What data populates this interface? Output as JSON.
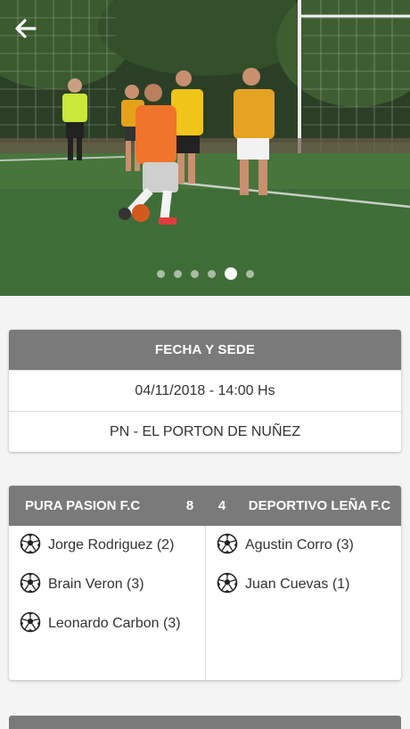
{
  "nav": {
    "back_icon": "arrow-left-icon"
  },
  "carousel": {
    "total": 6,
    "active_index": 4
  },
  "venue": {
    "header": "FECHA Y SEDE",
    "datetime": "04/11/2018 - 14:00 Hs",
    "location": "PN - EL PORTON DE NUÑEZ"
  },
  "match": {
    "home_team": "PURA PASION F.C",
    "home_score": "8",
    "away_score": "4",
    "away_team": "DEPORTIVO LEÑA F.C",
    "home_scorers": [
      "Jorge Rodriguez (2)",
      "Brain Veron (3)",
      "Leonardo Carbon (3)"
    ],
    "away_scorers": [
      "Agustin Corro (3)",
      "Juan Cuevas (1)"
    ]
  },
  "colors": {
    "header_bg": "#7a7a7a",
    "page_bg": "#f4f4f4"
  }
}
